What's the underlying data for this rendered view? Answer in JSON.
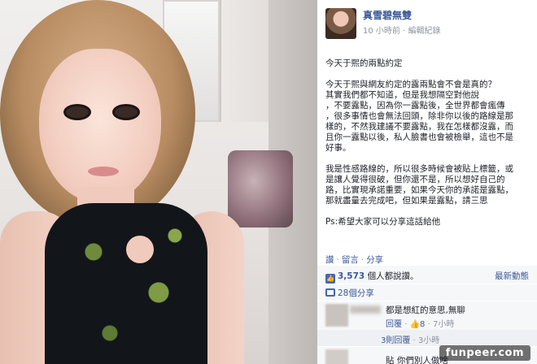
{
  "post": {
    "author": "真雪碧無雙",
    "time": "10 小時前",
    "edit_label": "編輯紀錄",
    "paragraphs": [
      "今天于熙的兩點約定",
      "今天于熙與網友約定的露兩點會不會是真的？\n其實我們都不知道，但是我想隔空對他說\n，不要露點，因為你一露點後，全世界都會瘋傳\n，很多事情也會無法回頭，除非你以後的路線是那\n樣的，不然我建議不要露點，我在怎樣都沒露，而\n且你一露點以後，私人臉書也會被檢舉，這也不是\n好事。",
      "我是性感路線的，所以很多時候會被貼上標籤，或\n是讓人覺得很破，但你還不是，所以想好自己的\n路，比實現承諾重要，如果今天你的承諾是露點，\n那就盡量去完成吧，但如果是露點，請三思",
      "Ps:希望大家可以分享這話給他"
    ]
  },
  "actions": {
    "like": "讚",
    "comment": "留言",
    "share": "分享"
  },
  "likes": {
    "count": "3,573",
    "suffix": "個人都說讚。",
    "newest": "最新動態"
  },
  "shares": {
    "label": "28個分享"
  },
  "comments": [
    {
      "text": "都是想紅的意思,無聊",
      "reply": "回覆",
      "likes": "8",
      "time": "7小時"
    },
    {
      "text": "貼 你們別人做啥"
    }
  ],
  "replies": {
    "label": "3則回覆",
    "time": "3小時"
  },
  "watermark": "funpeer.com"
}
